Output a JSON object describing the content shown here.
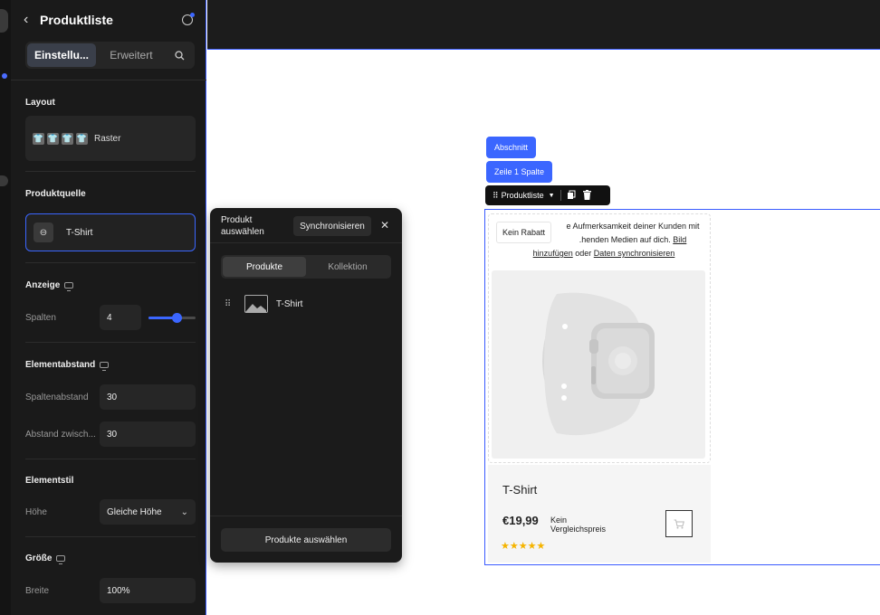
{
  "panel": {
    "title": "Produktliste",
    "tabs": {
      "settings": "Einstellu...",
      "advanced": "Erweitert"
    },
    "layout": {
      "heading": "Layout",
      "option": "Raster"
    },
    "source": {
      "heading": "Produktquelle",
      "value": "T-Shirt"
    },
    "display": {
      "heading": "Anzeige",
      "columns_label": "Spalten",
      "columns_value": "4",
      "columns_fraction": 0.6
    },
    "spacing": {
      "heading": "Elementabstand",
      "col_gap_label": "Spaltenabstand",
      "col_gap_value": "30",
      "row_gap_label": "Abstand zwisch...",
      "row_gap_value": "30"
    },
    "style": {
      "heading": "Elementstil",
      "height_label": "Höhe",
      "height_value": "Gleiche Höhe"
    },
    "size": {
      "heading": "Größe",
      "width_label": "Breite",
      "width_value": "100%"
    }
  },
  "popup": {
    "title": "Produkt auswählen",
    "sync_button": "Synchronisieren",
    "tabs": {
      "products": "Produkte",
      "collection": "Kollektion"
    },
    "item": "T-Shirt",
    "select_button": "Produkte auswählen"
  },
  "canvas": {
    "chip_section": "Abschnitt",
    "chip_row": "Zeile 1 Spalte",
    "toolbar_label": "Produktliste",
    "card": {
      "badge": "Kein Rabatt",
      "notice_start": "e Aufmerksamkeit deiner Kunden mit",
      "notice_mid": ".henden Medien auf dich.",
      "notice_link1_a": "Bild",
      "notice_link1_b": "hinzufügen",
      "notice_or": "oder",
      "notice_link2": "Daten synchronisieren",
      "title": "T-Shirt",
      "price": "€19,99",
      "compare_1": "Kein",
      "compare_2": "Vergleichspreis",
      "stars": "★★★★★",
      "rating": 5
    }
  },
  "colors": {
    "accent": "#3b66ff",
    "panel_bg": "#1a1a1a",
    "star": "#f5b400"
  }
}
